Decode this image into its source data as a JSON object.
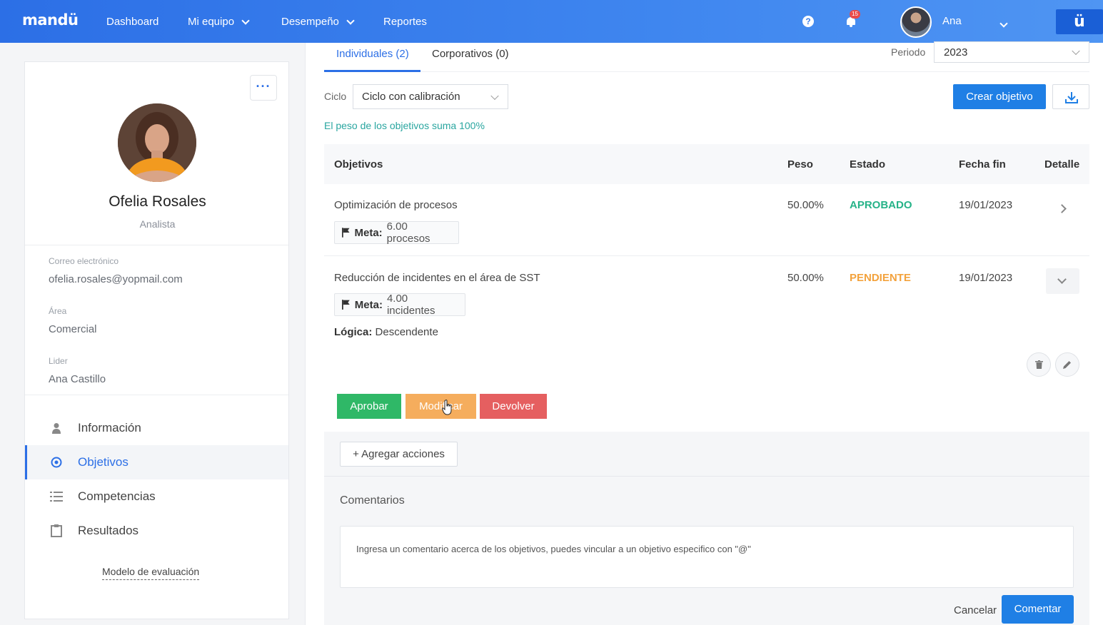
{
  "nav": {
    "logo": "mandü",
    "items": [
      {
        "label": "Dashboard",
        "dropdown": false
      },
      {
        "label": "Mi equipo",
        "dropdown": true
      },
      {
        "label": "Desempeño",
        "dropdown": true
      },
      {
        "label": "Reportes",
        "dropdown": false
      }
    ],
    "help": "?",
    "notifications_count": "15",
    "user_name": "Ana",
    "brand_mark": "ü"
  },
  "profile": {
    "more_button": "···",
    "name": "Ofelia Rosales",
    "role": "Analista",
    "fields": [
      {
        "label": "Correo electrónico",
        "value": "ofelia.rosales@yopmail.com"
      },
      {
        "label": "Área",
        "value": "Comercial"
      },
      {
        "label": "Lider",
        "value": "Ana Castillo"
      }
    ],
    "menu": [
      {
        "label": "Información",
        "icon": "person-icon",
        "active": false
      },
      {
        "label": "Objetivos",
        "icon": "target-icon",
        "active": true
      },
      {
        "label": "Competencias",
        "icon": "list-icon",
        "active": false
      },
      {
        "label": "Resultados",
        "icon": "clipboard-icon",
        "active": false
      }
    ],
    "modelo_link": "Modelo de evaluación"
  },
  "main": {
    "tabs": [
      {
        "label": "Individuales (2)",
        "active": true
      },
      {
        "label": "Corporativos (0)",
        "active": false
      }
    ],
    "periodo_label": "Periodo",
    "periodo_value": "2023",
    "ciclo_label": "Ciclo",
    "ciclo_value": "Ciclo con calibración",
    "crear_button": "Crear objetivo",
    "peso_message": "El peso de los objetivos suma 100%",
    "table": {
      "headers": [
        "Objetivos",
        "Peso",
        "Estado",
        "Fecha fin",
        "Detalle"
      ],
      "rows": [
        {
          "title": "Optimización de procesos",
          "meta_label": "Meta:",
          "meta_value": "6.00 procesos",
          "peso": "50.00%",
          "estado": "APROBADO",
          "fecha": "19/01/2023"
        },
        {
          "title": "Reducción de incidentes en el área de SST",
          "meta_label": "Meta:",
          "meta_value": "4.00 incidentes",
          "logica_label": "Lógica:",
          "logica_value": "Descendente",
          "peso": "50.00%",
          "estado": "PENDIENTE",
          "fecha": "19/01/2023"
        }
      ]
    },
    "actions": {
      "aprobar": "Aprobar",
      "modificar": "Modificar",
      "devolver": "Devolver"
    },
    "colors": {
      "aprobar": "#2fb867",
      "modificar": "#f5ad5d",
      "devolver": "#e55f60",
      "accent": "#1f7fe5"
    },
    "agregar_button": "+ Agregar acciones",
    "comentarios_title": "Comentarios",
    "comment_placeholder": "Ingresa un comentario acerca de los objetivos, puedes vincular a un objetivo especifico con \"@\"",
    "cancelar": "Cancelar",
    "comentar": "Comentar"
  }
}
